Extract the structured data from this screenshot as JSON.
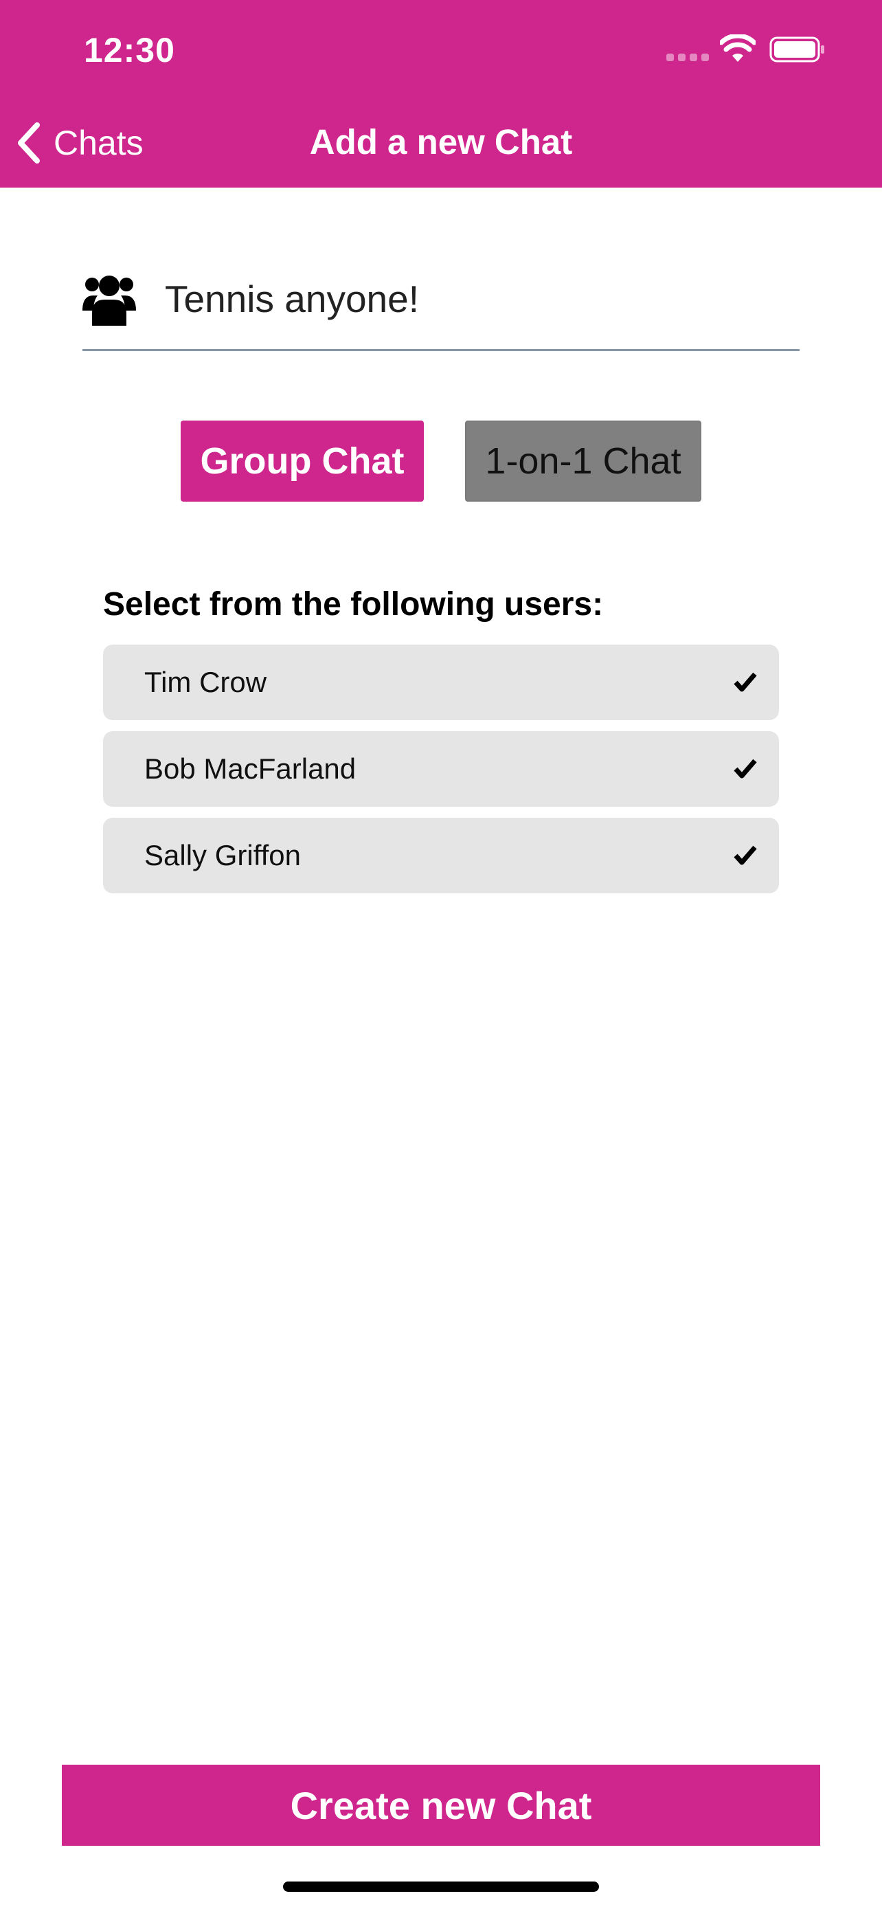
{
  "status_bar": {
    "time": "12:30"
  },
  "nav": {
    "back_label": "Chats",
    "title": "Add a new Chat"
  },
  "chat_name": {
    "value": "Tennis anyone!",
    "icon": "users-group-icon"
  },
  "chat_type": {
    "group_label": "Group Chat",
    "one_on_one_label": "1-on-1 Chat",
    "selected": "Group Chat"
  },
  "users": {
    "label": "Select from the following users:",
    "items": [
      {
        "name": "Tim Crow",
        "selected": true
      },
      {
        "name": "Bob MacFarland",
        "selected": true
      },
      {
        "name": "Sally Griffon",
        "selected": true
      }
    ]
  },
  "actions": {
    "create_label": "Create new Chat"
  },
  "colors": {
    "accent": "#CF268D",
    "inactive_button": "#808080",
    "list_item_bg": "#E5E5E5",
    "underline": "#8796A6"
  }
}
